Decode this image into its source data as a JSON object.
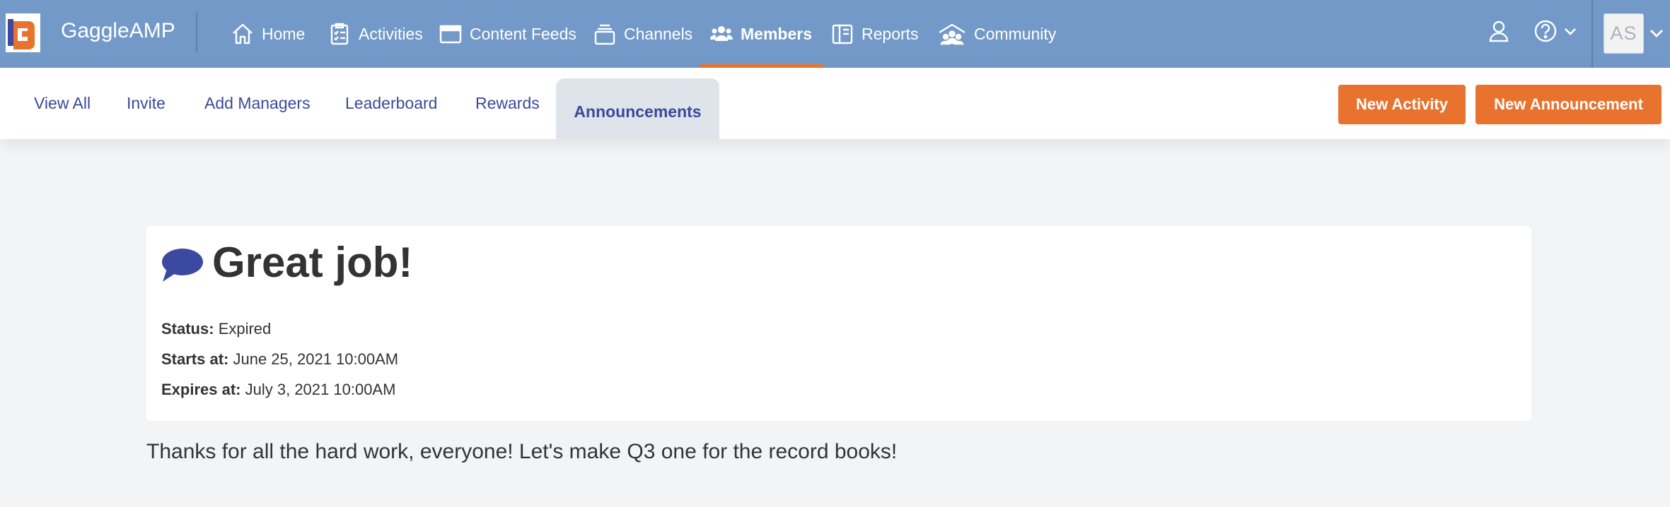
{
  "app": {
    "name": "GaggleAMP"
  },
  "nav": {
    "items": [
      {
        "label": "Home",
        "icon": "home-icon"
      },
      {
        "label": "Activities",
        "icon": "clipboard-icon"
      },
      {
        "label": "Content Feeds",
        "icon": "feed-icon"
      },
      {
        "label": "Channels",
        "icon": "layers-icon"
      },
      {
        "label": "Members",
        "icon": "members-icon",
        "active": true
      },
      {
        "label": "Reports",
        "icon": "book-icon"
      },
      {
        "label": "Community",
        "icon": "community-icon"
      }
    ],
    "avatar_initials": "AS"
  },
  "subnav": {
    "items": [
      {
        "label": "View All"
      },
      {
        "label": "Invite"
      },
      {
        "label": "Add Managers"
      },
      {
        "label": "Leaderboard"
      },
      {
        "label": "Rewards"
      },
      {
        "label": "Announcements",
        "active": true
      }
    ],
    "buttons": {
      "new_activity": "New Activity",
      "new_announcement": "New Announcement"
    }
  },
  "announcement": {
    "title": "Great job!",
    "status_label": "Status:",
    "status_value": "Expired",
    "starts_label": "Starts at:",
    "starts_value": "June 25, 2021 10:00AM",
    "expires_label": "Expires at:",
    "expires_value": "July 3, 2021 10:00AM",
    "message": "Thanks for all the hard work, everyone! Let's make Q3 one for the record books!"
  },
  "colors": {
    "topbar": "#7399c9",
    "accent": "#e8732e",
    "link": "#3a4a9a",
    "bubble": "#3b4aa0"
  }
}
